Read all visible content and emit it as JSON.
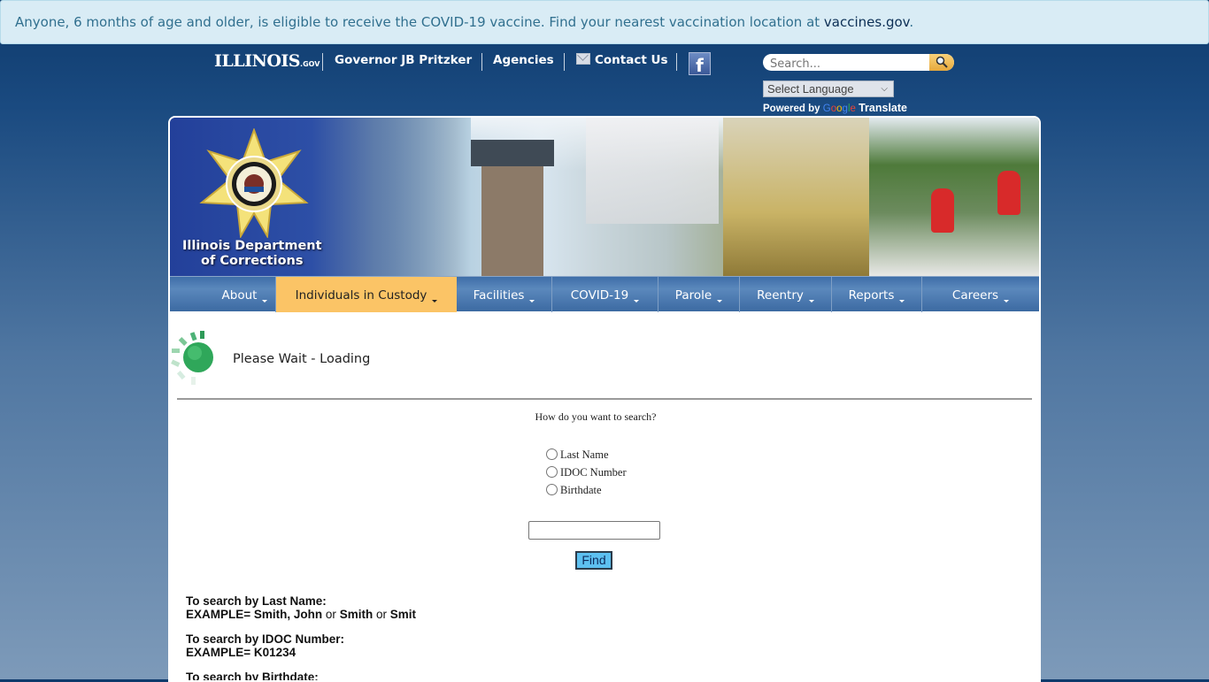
{
  "alert": {
    "text": "Anyone, 6 months of age and older, is eligible to receive the COVID-19 vaccine. Find your nearest vaccination location at ",
    "link": "vaccines.gov",
    "suffix": "."
  },
  "topbar": {
    "logo_main": "ILLINOIS",
    "logo_suffix": ".GOV",
    "links": [
      "Governor JB Pritzker",
      "Agencies",
      "Contact Us"
    ],
    "facebook_glyph": "f",
    "search_placeholder": "Search...",
    "language_select": "Select Language",
    "powered_by": "Powered by",
    "google": [
      "G",
      "o",
      "o",
      "g",
      "l",
      "e"
    ],
    "translate": "Translate"
  },
  "banner": {
    "title_line1": "Illinois Department",
    "title_line2": "of Corrections"
  },
  "nav": {
    "items": [
      {
        "label": "About"
      },
      {
        "label": "Individuals in Custody",
        "active": true
      },
      {
        "label": "Facilities"
      },
      {
        "label": "COVID-19"
      },
      {
        "label": "Parole"
      },
      {
        "label": "Reentry"
      },
      {
        "label": "Reports"
      },
      {
        "label": "Careers"
      }
    ]
  },
  "loading": {
    "text": "Please Wait - Loading"
  },
  "form": {
    "question": "How do you want to search?",
    "options": [
      "Last Name",
      "IDOC Number",
      "Birthdate"
    ],
    "input_value": "",
    "find_label": "Find"
  },
  "help": {
    "last_name_heading": "To search by Last Name:",
    "last_name_example_prefix": "EXAMPLE= Smith, John",
    "or": "or",
    "last_name_example_2": "Smith",
    "last_name_example_3": "Smit",
    "idoc_heading": "To search by IDOC Number:",
    "idoc_example": "EXAMPLE= K01234",
    "birthdate_heading": "To search by Birthdate:"
  },
  "colors": {
    "alert_bg": "#d9ecf5",
    "alert_text": "#31708f",
    "nav_active": "#fbc466",
    "find_button": "#5dc0f0"
  }
}
